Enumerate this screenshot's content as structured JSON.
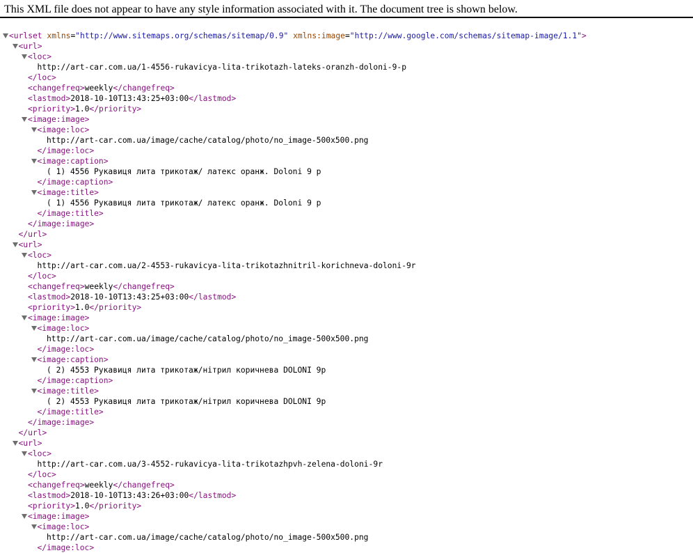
{
  "banner": "This XML file does not appear to have any style information associated with it. The document tree is shown below.",
  "root": {
    "open": "<urlset",
    "attr1_name": "xmlns",
    "attr1_value": "\"http://www.sitemaps.org/schemas/sitemap/0.9\"",
    "attr2_name": "xmlns:image",
    "attr2_value": "\"http://www.google.com/schemas/sitemap-image/1.1\"",
    "close": ">"
  },
  "tags": {
    "url_open": "<url>",
    "url_close": "</url>",
    "loc_open": "<loc>",
    "loc_close": "</loc>",
    "changefreq_open": "<changefreq>",
    "changefreq_close": "</changefreq>",
    "lastmod_open": "<lastmod>",
    "lastmod_close": "</lastmod>",
    "priority_open": "<priority>",
    "priority_close": "</priority>",
    "image_open": "<image:image>",
    "image_close": "</image:image>",
    "imgloc_open": "<image:loc>",
    "imgloc_close": "</image:loc>",
    "caption_open": "<image:caption>",
    "caption_close": "</image:caption>",
    "title_open": "<image:title>",
    "title_close": "</image:title>"
  },
  "urls": [
    {
      "loc": "http://art-car.com.ua/1-4556-rukavicya-lita-trikotazh-lateks-oranzh-doloni-9-p",
      "changefreq": "weekly",
      "lastmod": "2018-10-10T13:43:25+03:00",
      "priority": "1.0",
      "image_loc": "http://art-car.com.ua/image/cache/catalog/photo/no_image-500x500.png",
      "caption": "( 1) 4556 Рукавиця лита трикотаж/ латекс оранж. Doloni 9 р",
      "title": "( 1) 4556 Рукавиця лита трикотаж/ латекс оранж. Doloni 9 р"
    },
    {
      "loc": "http://art-car.com.ua/2-4553-rukavicya-lita-trikotazhnitril-korichneva-doloni-9r",
      "changefreq": "weekly",
      "lastmod": "2018-10-10T13:43:25+03:00",
      "priority": "1.0",
      "image_loc": "http://art-car.com.ua/image/cache/catalog/photo/no_image-500x500.png",
      "caption": "( 2) 4553 Рукавиця лита трикотаж/нітрил коричнева DOLONI 9р",
      "title": "( 2) 4553 Рукавиця лита трикотаж/нітрил коричнева DOLONI 9р"
    },
    {
      "loc": "http://art-car.com.ua/3-4552-rukavicya-lita-trikotazhpvh-zelena-doloni-9r",
      "changefreq": "weekly",
      "lastmod": "2018-10-10T13:43:26+03:00",
      "priority": "1.0",
      "image_loc": "http://art-car.com.ua/image/cache/catalog/photo/no_image-500x500.png"
    }
  ]
}
